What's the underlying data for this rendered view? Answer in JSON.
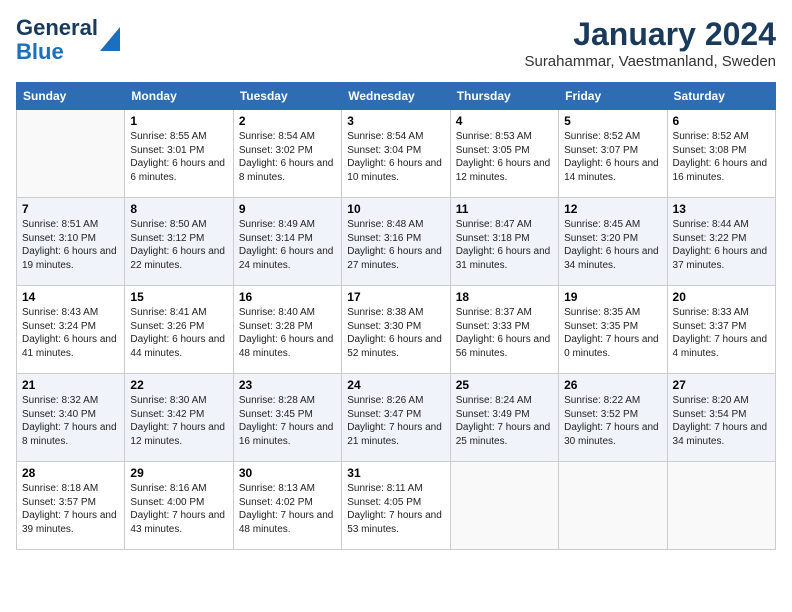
{
  "header": {
    "logo_line1": "General",
    "logo_line2": "Blue",
    "title": "January 2024",
    "subtitle": "Surahammar, Vaestmanland, Sweden"
  },
  "columns": [
    "Sunday",
    "Monday",
    "Tuesday",
    "Wednesday",
    "Thursday",
    "Friday",
    "Saturday"
  ],
  "weeks": [
    [
      {
        "day": "",
        "empty": true
      },
      {
        "day": "1",
        "sunrise": "8:55 AM",
        "sunset": "3:01 PM",
        "daylight": "6 hours and 6 minutes."
      },
      {
        "day": "2",
        "sunrise": "8:54 AM",
        "sunset": "3:02 PM",
        "daylight": "6 hours and 8 minutes."
      },
      {
        "day": "3",
        "sunrise": "8:54 AM",
        "sunset": "3:04 PM",
        "daylight": "6 hours and 10 minutes."
      },
      {
        "day": "4",
        "sunrise": "8:53 AM",
        "sunset": "3:05 PM",
        "daylight": "6 hours and 12 minutes."
      },
      {
        "day": "5",
        "sunrise": "8:52 AM",
        "sunset": "3:07 PM",
        "daylight": "6 hours and 14 minutes."
      },
      {
        "day": "6",
        "sunrise": "8:52 AM",
        "sunset": "3:08 PM",
        "daylight": "6 hours and 16 minutes."
      }
    ],
    [
      {
        "day": "7",
        "sunrise": "8:51 AM",
        "sunset": "3:10 PM",
        "daylight": "6 hours and 19 minutes."
      },
      {
        "day": "8",
        "sunrise": "8:50 AM",
        "sunset": "3:12 PM",
        "daylight": "6 hours and 22 minutes."
      },
      {
        "day": "9",
        "sunrise": "8:49 AM",
        "sunset": "3:14 PM",
        "daylight": "6 hours and 24 minutes."
      },
      {
        "day": "10",
        "sunrise": "8:48 AM",
        "sunset": "3:16 PM",
        "daylight": "6 hours and 27 minutes."
      },
      {
        "day": "11",
        "sunrise": "8:47 AM",
        "sunset": "3:18 PM",
        "daylight": "6 hours and 31 minutes."
      },
      {
        "day": "12",
        "sunrise": "8:45 AM",
        "sunset": "3:20 PM",
        "daylight": "6 hours and 34 minutes."
      },
      {
        "day": "13",
        "sunrise": "8:44 AM",
        "sunset": "3:22 PM",
        "daylight": "6 hours and 37 minutes."
      }
    ],
    [
      {
        "day": "14",
        "sunrise": "8:43 AM",
        "sunset": "3:24 PM",
        "daylight": "6 hours and 41 minutes."
      },
      {
        "day": "15",
        "sunrise": "8:41 AM",
        "sunset": "3:26 PM",
        "daylight": "6 hours and 44 minutes."
      },
      {
        "day": "16",
        "sunrise": "8:40 AM",
        "sunset": "3:28 PM",
        "daylight": "6 hours and 48 minutes."
      },
      {
        "day": "17",
        "sunrise": "8:38 AM",
        "sunset": "3:30 PM",
        "daylight": "6 hours and 52 minutes."
      },
      {
        "day": "18",
        "sunrise": "8:37 AM",
        "sunset": "3:33 PM",
        "daylight": "6 hours and 56 minutes."
      },
      {
        "day": "19",
        "sunrise": "8:35 AM",
        "sunset": "3:35 PM",
        "daylight": "7 hours and 0 minutes."
      },
      {
        "day": "20",
        "sunrise": "8:33 AM",
        "sunset": "3:37 PM",
        "daylight": "7 hours and 4 minutes."
      }
    ],
    [
      {
        "day": "21",
        "sunrise": "8:32 AM",
        "sunset": "3:40 PM",
        "daylight": "7 hours and 8 minutes."
      },
      {
        "day": "22",
        "sunrise": "8:30 AM",
        "sunset": "3:42 PM",
        "daylight": "7 hours and 12 minutes."
      },
      {
        "day": "23",
        "sunrise": "8:28 AM",
        "sunset": "3:45 PM",
        "daylight": "7 hours and 16 minutes."
      },
      {
        "day": "24",
        "sunrise": "8:26 AM",
        "sunset": "3:47 PM",
        "daylight": "7 hours and 21 minutes."
      },
      {
        "day": "25",
        "sunrise": "8:24 AM",
        "sunset": "3:49 PM",
        "daylight": "7 hours and 25 minutes."
      },
      {
        "day": "26",
        "sunrise": "8:22 AM",
        "sunset": "3:52 PM",
        "daylight": "7 hours and 30 minutes."
      },
      {
        "day": "27",
        "sunrise": "8:20 AM",
        "sunset": "3:54 PM",
        "daylight": "7 hours and 34 minutes."
      }
    ],
    [
      {
        "day": "28",
        "sunrise": "8:18 AM",
        "sunset": "3:57 PM",
        "daylight": "7 hours and 39 minutes."
      },
      {
        "day": "29",
        "sunrise": "8:16 AM",
        "sunset": "4:00 PM",
        "daylight": "7 hours and 43 minutes."
      },
      {
        "day": "30",
        "sunrise": "8:13 AM",
        "sunset": "4:02 PM",
        "daylight": "7 hours and 48 minutes."
      },
      {
        "day": "31",
        "sunrise": "8:11 AM",
        "sunset": "4:05 PM",
        "daylight": "7 hours and 53 minutes."
      },
      {
        "day": "",
        "empty": true
      },
      {
        "day": "",
        "empty": true
      },
      {
        "day": "",
        "empty": true
      }
    ]
  ]
}
